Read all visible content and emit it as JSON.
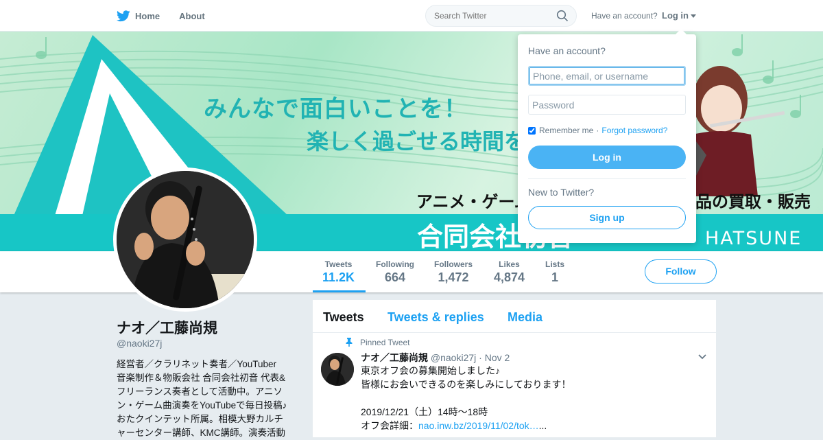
{
  "nav": {
    "home_label": "Home",
    "about_label": "About",
    "search_placeholder": "Search Twitter",
    "have_account": "Have an account?",
    "login_label": "Log in"
  },
  "banner": {
    "line1": "みんなで面白いことを！",
    "line2": "楽しく過ごせる時間を",
    "line3a": "アニメ・ゲーム",
    "line3b": "品の買取・販売",
    "line4": "合同会社初音",
    "company": "HATSUNE LLC."
  },
  "stats": [
    {
      "label": "Tweets",
      "value": "11.2K"
    },
    {
      "label": "Following",
      "value": "664"
    },
    {
      "label": "Followers",
      "value": "1,472"
    },
    {
      "label": "Likes",
      "value": "4,874"
    },
    {
      "label": "Lists",
      "value": "1"
    }
  ],
  "follow_label": "Follow",
  "profile": {
    "name": "ナオ／工藤尚規",
    "handle": "@naoki27j",
    "bio_lines": [
      "経営者／クラリネット奏者／YouTuber",
      "音楽制作＆物販会社 合同会社初音 代表&",
      "フリーランス奏者として活動中。アニソ",
      "ン・ゲーム曲演奏をYouTubeで毎日投稿♪",
      "おたクインテット所属。相模大野カルチ",
      "ャーセンター講師、KMC講師。演奏活動"
    ]
  },
  "timeline": {
    "tabs": [
      "Tweets",
      "Tweets & replies",
      "Media"
    ],
    "pinned_label": "Pinned Tweet",
    "tweet": {
      "name": "ナオ／工藤尚規",
      "handle": "@naoki27j",
      "sep": "·",
      "date": "Nov 2",
      "lines": [
        "東京オフ会の募集開始しました♪",
        "皆様にお会いできるのを楽しみにしております！",
        "",
        "2019/12/21（土）14時～18時"
      ],
      "detail_prefix": "オフ会詳細：",
      "link": "nao.inw.bz/2019/11/02/tok…",
      "link_suffix": "..."
    }
  },
  "login_dropdown": {
    "title": "Have an account?",
    "username_placeholder": "Phone, email, or username",
    "password_placeholder": "Password",
    "remember": "Remember me",
    "sep": "·",
    "forgot": "Forgot password?",
    "login_button": "Log in",
    "new_label": "New to Twitter?",
    "signup_button": "Sign up"
  },
  "colors": {
    "accent": "#1da1f2",
    "login_button": "#4ab3f4",
    "banner_band": "#17c6c6"
  }
}
